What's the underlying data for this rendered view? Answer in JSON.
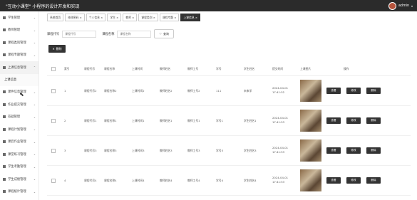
{
  "header": {
    "title": "\"互动小课堂\" 小程序的设计开发和实现",
    "user": "admin"
  },
  "sidebar": {
    "items": [
      {
        "label": "学生管理"
      },
      {
        "label": "教师管理"
      },
      {
        "label": "课程类别管理"
      },
      {
        "label": "课程专题管理"
      },
      {
        "label": "上课信息管理"
      },
      {
        "label": "上课信息",
        "sub": true
      },
      {
        "label": "课件信息管理"
      },
      {
        "label": "作业提交管理"
      },
      {
        "label": "答疑管理"
      },
      {
        "label": "课程计划管理"
      },
      {
        "label": "课后作业管理"
      },
      {
        "label": "课堂练习管理"
      },
      {
        "label": "学生考勤管理"
      },
      {
        "label": "学生成绩管理"
      },
      {
        "label": "课程统计管理"
      }
    ]
  },
  "tabs": [
    {
      "label": "系统首页"
    },
    {
      "label": "修改密码 ×"
    },
    {
      "label": "个人信息 ×"
    },
    {
      "label": "学生 ×"
    },
    {
      "label": "教师 ×"
    },
    {
      "label": "课程类别 ×"
    },
    {
      "label": "课程专题 ×"
    },
    {
      "label": "上课信息 ×",
      "active": true
    }
  ],
  "search": {
    "code_label": "课程代号",
    "code_placeholder": "课程代号",
    "name_label": "课程名称",
    "name_placeholder": "课程名称",
    "query_label": "查询"
  },
  "delete_all_label": "删除",
  "table": {
    "columns": [
      "",
      "索引",
      "课程代号",
      "课程名称",
      "上课时间",
      "教师姓名",
      "教师工号",
      "学号",
      "学生姓名",
      "提交时间",
      "上课图片",
      "操作"
    ],
    "rows": [
      {
        "index": "1",
        "code": "课程代号2",
        "name": "课程名称2",
        "time": "上课时间2",
        "teacher": "教师姓名2",
        "teacher_no": "教师工号2",
        "student_no": "111",
        "student_name": "未来学",
        "submit": "2024-04-01 17:41:52"
      },
      {
        "index": "2",
        "code": "课程代号1",
        "name": "课程名称1",
        "time": "上课时间1",
        "teacher": "教师姓名1",
        "teacher_no": "教师工号1",
        "student_no": "学号1",
        "student_name": "学生姓名1",
        "submit": "2024-04-01 17:41:53"
      },
      {
        "index": "3",
        "code": "课程代号3",
        "name": "课程名称3",
        "time": "上课时间3",
        "teacher": "教师姓名3",
        "teacher_no": "教师工号3",
        "student_no": "学号3",
        "student_name": "学生姓名3",
        "submit": "2024-04-01 17:41:53"
      },
      {
        "index": "4",
        "code": "课程代号4",
        "name": "课程名称4",
        "time": "上课时间4",
        "teacher": "教师姓名4",
        "teacher_no": "教师工号4",
        "student_no": "学号4",
        "student_name": "学生姓名4",
        "submit": "2024-04-01 17:41:53"
      }
    ],
    "actions": {
      "view": "查看",
      "edit": "修改",
      "delete": "删除"
    }
  }
}
